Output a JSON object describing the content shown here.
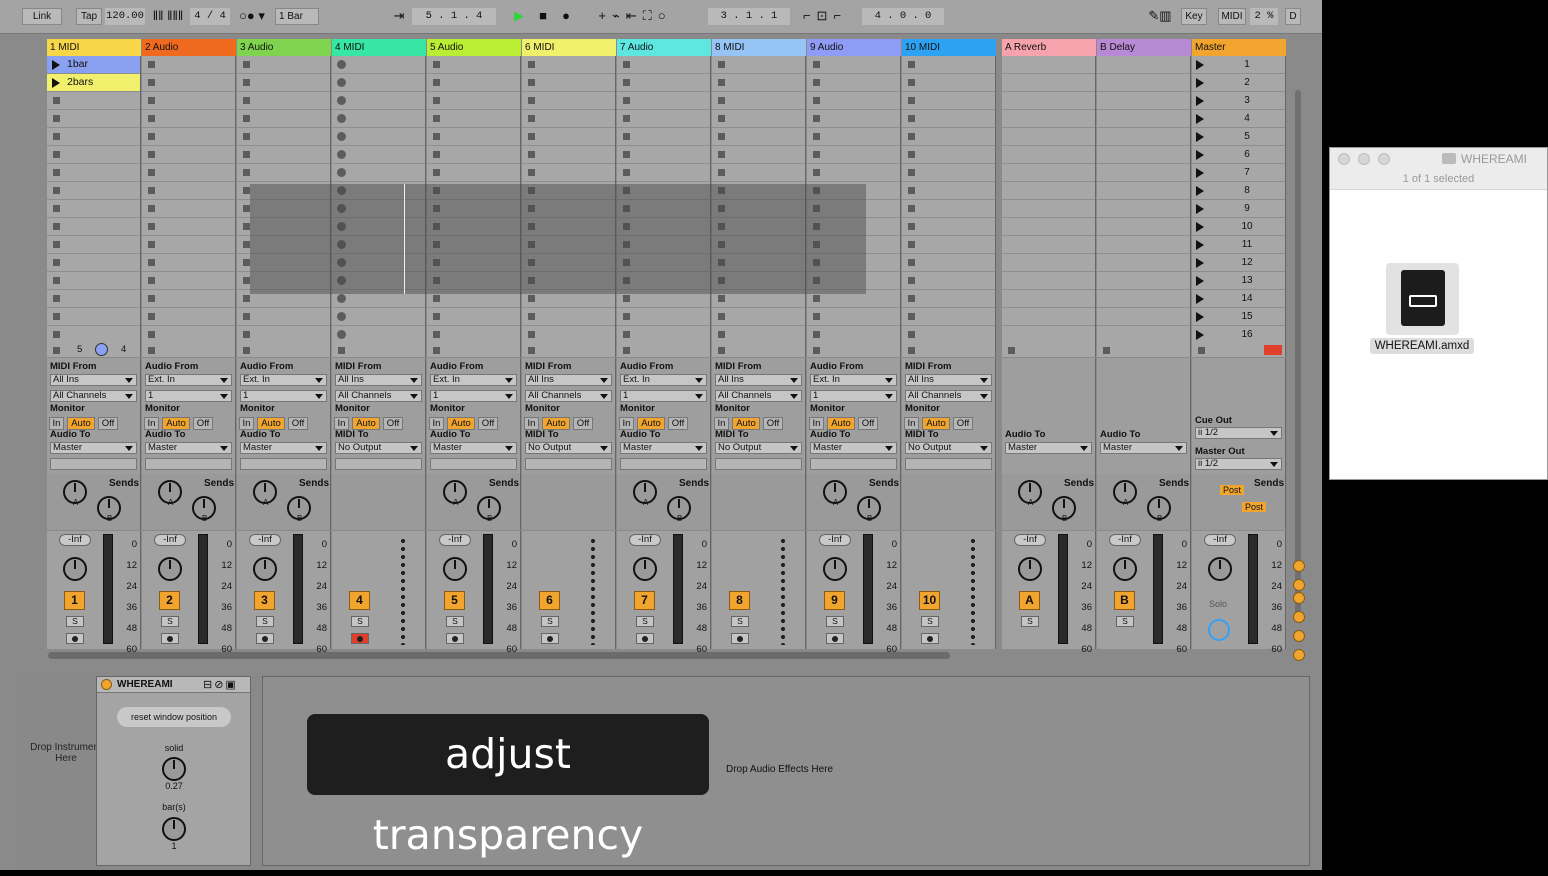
{
  "toolbar": {
    "link": "Link",
    "tap": "Tap",
    "tempo": "120.00",
    "signature": "4 / 4",
    "quant": "1 Bar",
    "position": "5 .   1 .   4",
    "loop_start": "3 .   1 .   1",
    "loop_len": "4 .   0 .   0",
    "key": "Key",
    "midi": "MIDI",
    "cpu": "2 %",
    "d": "D"
  },
  "tracks": [
    {
      "name": "1 MIDI",
      "color": "#f7d64a",
      "num": "1",
      "type": "midi",
      "from": "MIDI From",
      "src": "All Ins",
      "ch": "All Channels",
      "to_lbl": "Audio To",
      "to": "Master",
      "monitor": "Auto"
    },
    {
      "name": "2 Audio",
      "color": "#ef6a1e",
      "num": "2",
      "type": "audio",
      "from": "Audio From",
      "src": "Ext. In",
      "ch": "1",
      "to_lbl": "Audio To",
      "to": "Master",
      "monitor": "Auto"
    },
    {
      "name": "3 Audio",
      "color": "#7fd34e",
      "num": "3",
      "type": "audio",
      "from": "Audio From",
      "src": "Ext. In",
      "ch": "1",
      "to_lbl": "Audio To",
      "to": "Master",
      "monitor": "Auto"
    },
    {
      "name": "4 MIDI",
      "color": "#36e6a2",
      "num": "4",
      "type": "midi",
      "from": "MIDI From",
      "src": "All Ins",
      "ch": "All Channels",
      "to_lbl": "MIDI To",
      "to": "No Output",
      "monitor": "Auto"
    },
    {
      "name": "5 Audio",
      "color": "#b9ee33",
      "num": "5",
      "type": "audio",
      "from": "Audio From",
      "src": "Ext. In",
      "ch": "1",
      "to_lbl": "Audio To",
      "to": "Master",
      "monitor": "Auto"
    },
    {
      "name": "6 MIDI",
      "color": "#f1f06d",
      "num": "6",
      "type": "midi",
      "from": "MIDI From",
      "src": "All Ins",
      "ch": "All Channels",
      "to_lbl": "MIDI To",
      "to": "No Output",
      "monitor": "Auto"
    },
    {
      "name": "7 Audio",
      "color": "#5ee6e0",
      "num": "7",
      "type": "audio",
      "from": "Audio From",
      "src": "Ext. In",
      "ch": "1",
      "to_lbl": "Audio To",
      "to": "Master",
      "monitor": "Auto"
    },
    {
      "name": "8 MIDI",
      "color": "#95c4f5",
      "num": "8",
      "type": "midi",
      "from": "MIDI From",
      "src": "All Ins",
      "ch": "All Channels",
      "to_lbl": "MIDI To",
      "to": "No Output",
      "monitor": "Auto"
    },
    {
      "name": "9 Audio",
      "color": "#8f9cf5",
      "num": "9",
      "type": "audio",
      "from": "Audio From",
      "src": "Ext. In",
      "ch": "1",
      "to_lbl": "Audio To",
      "to": "Master",
      "monitor": "Auto"
    },
    {
      "name": "10 MIDI",
      "color": "#2ea2f2",
      "num": "10",
      "type": "midi",
      "from": "MIDI From",
      "src": "All Ins",
      "ch": "All Channels",
      "to_lbl": "MIDI To",
      "to": "No Output",
      "monitor": "Auto"
    }
  ],
  "returns": [
    {
      "name": "A Reverb",
      "color": "#f6a3ad",
      "num": "A",
      "to_lbl": "Audio To",
      "to": "Master"
    },
    {
      "name": "B Delay",
      "color": "#b889d4",
      "num": "B",
      "to_lbl": "Audio To",
      "to": "Master"
    }
  ],
  "master": {
    "name": "Master",
    "color": "#f2a52e",
    "cue_lbl": "Cue Out",
    "cue": "ii 1/2",
    "out_lbl": "Master Out",
    "out": "ii 1/2",
    "solo": "Solo",
    "post": "Post"
  },
  "clips": [
    {
      "name": "1bar",
      "color": "#8aa0f0"
    },
    {
      "name": "2bars",
      "color": "#f1f06d"
    }
  ],
  "scenes": [
    "1",
    "2",
    "3",
    "4",
    "5",
    "6",
    "7",
    "8",
    "9",
    "10",
    "11",
    "12",
    "13",
    "14",
    "15",
    "16"
  ],
  "labels": {
    "sends": "Sends",
    "monitor": "Monitor",
    "in": "In",
    "auto": "Auto",
    "off": "Off",
    "inf": "-Inf",
    "s": "S",
    "send_a": "A",
    "send_b": "B",
    "status_5": "5",
    "status_4": "4"
  },
  "meter_scale": [
    "0",
    "12",
    "24",
    "36",
    "48",
    "60"
  ],
  "device": {
    "title": "WHEREAMI",
    "reset": "reset window position",
    "solid": "solid",
    "solid_val": "0.27",
    "bars": "bar(s)",
    "bars_val": "1",
    "drop_instr": "Drop Instrument Here",
    "drop_fx": "Drop Audio Effects Here",
    "caption": "adjust transparency"
  },
  "finder": {
    "title": "WHEREAMI",
    "subtitle": "1 of 1 selected",
    "file": "WHEREAMI.amxd"
  }
}
